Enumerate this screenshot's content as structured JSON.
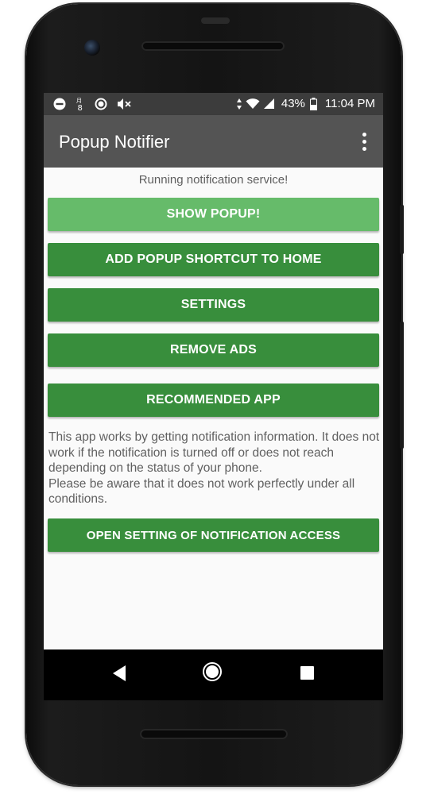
{
  "status_bar": {
    "battery": "43%",
    "time": "11:04 PM",
    "icons_left": [
      "do-not-disturb-icon",
      "calendar-icon",
      "record-icon",
      "mute-icon"
    ],
    "icons_right": [
      "data-arrows-icon",
      "wifi-icon",
      "cell-signal-icon",
      "battery-icon"
    ],
    "calendar_day": "8"
  },
  "app_bar": {
    "title": "Popup Notifier",
    "overflow_icon": "more-vert-icon"
  },
  "main": {
    "status_message": "Running notification service!",
    "buttons": {
      "show_popup": "SHOW POPUP!",
      "add_shortcut": "ADD POPUP SHORTCUT TO HOME",
      "settings": "SETTINGS",
      "remove_ads": "REMOVE ADS",
      "recommended_app": "RECOMMENDED APP",
      "open_notification_access": "OPEN SETTING OF NOTIFICATION ACCESS"
    },
    "info_paragraph_1": "This app works by getting notification information. It does not work if the notification is turned off or does not reach depending on the status of your phone.",
    "info_paragraph_2": "Please be aware that it does not work perfectly under all conditions."
  },
  "nav_bar": {
    "icons": [
      "back-icon",
      "home-icon",
      "recents-icon"
    ]
  },
  "colors": {
    "button_green": "#388e3c",
    "button_light_green": "#66bb6a",
    "app_bar": "#545454",
    "status_bar": "#3c3c3c",
    "content_bg": "#fafafa"
  }
}
